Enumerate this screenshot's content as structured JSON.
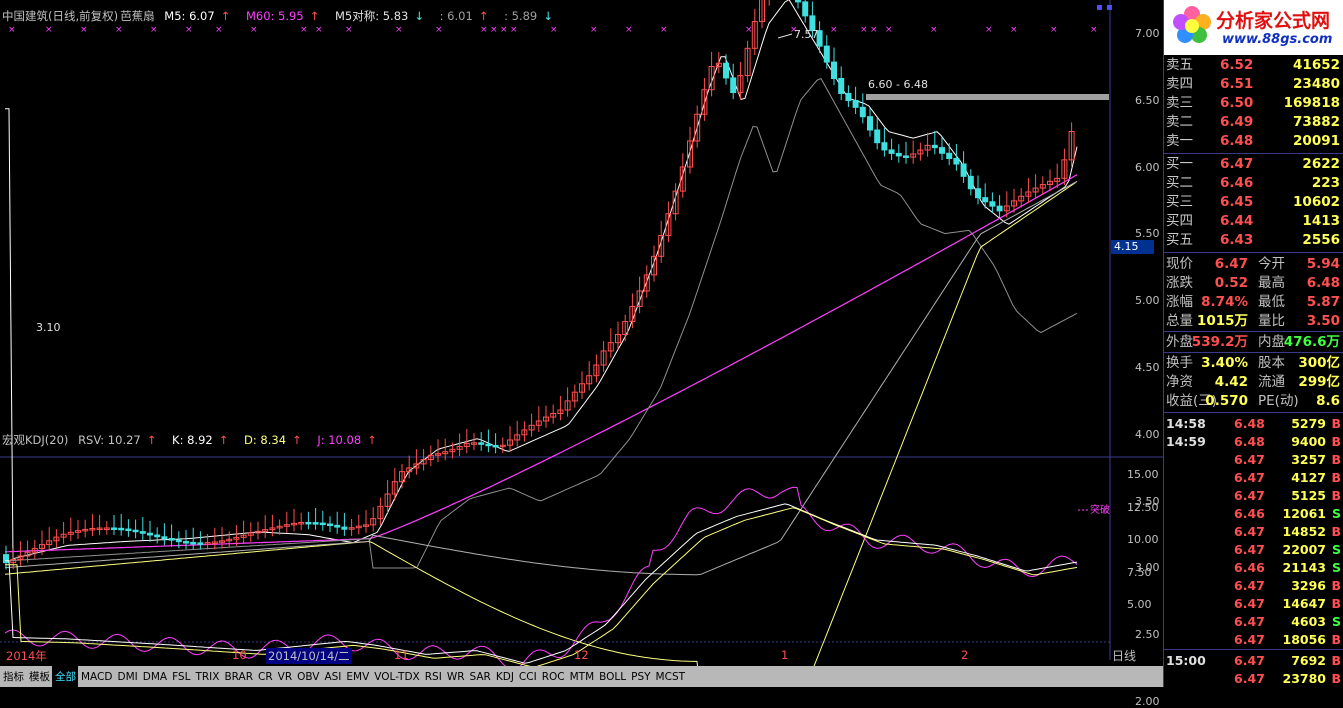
{
  "header": {
    "title": "中国建筑(日线,前复权)",
    "indicator_name": "芭蕉扇",
    "m5": "M5: 6.07",
    "m60": "M60: 5.95",
    "m5sym": "M5对称: 5.83",
    "v1": ": 6.01",
    "v2": ": 5.89"
  },
  "kdj_header": {
    "name": "宏观KDJ(20)",
    "rsv": "RSV: 10.27",
    "k": "K: 8.92",
    "d": "D: 8.34",
    "j": "J: 10.08"
  },
  "chart_annotations": {
    "high": "7.57",
    "resistance": "6.60 - 6.48",
    "low": "3.10",
    "breakout": "突破",
    "current_price_tag": "4.15"
  },
  "price_axis": [
    "7.00",
    "6.50",
    "6.00",
    "5.50",
    "5.00",
    "4.50",
    "4.00",
    "3.50",
    "3.00",
    "2.50",
    "2.00"
  ],
  "kdj_axis": [
    "15.00",
    "12.50",
    "10.00",
    "7.50",
    "5.00"
  ],
  "date_axis": {
    "year": "2014年",
    "m10": "10",
    "cursor": "2014/10/14/二",
    "m11": "11",
    "m12": "12",
    "m1": "1",
    "m2": "2",
    "period": "日线"
  },
  "tabs": [
    "指标",
    "模板",
    "全部",
    "MACD",
    "DMI",
    "DMA",
    "FSL",
    "TRIX",
    "BRAR",
    "CR",
    "VR",
    "OBV",
    "ASI",
    "EMV",
    "VOL-TDX",
    "RSI",
    "WR",
    "SAR",
    "KDJ",
    "CCI",
    "ROC",
    "MTM",
    "BOLL",
    "PSY",
    "MCST"
  ],
  "logo": {
    "title": "分析家公式网",
    "url": "www.88gs.com"
  },
  "sell_orders": [
    {
      "label": "卖五",
      "price": "6.52",
      "vol": "41652"
    },
    {
      "label": "卖四",
      "price": "6.51",
      "vol": "23480"
    },
    {
      "label": "卖三",
      "price": "6.50",
      "vol": "169818"
    },
    {
      "label": "卖二",
      "price": "6.49",
      "vol": "73882"
    },
    {
      "label": "卖一",
      "price": "6.48",
      "vol": "20091"
    }
  ],
  "buy_orders": [
    {
      "label": "买一",
      "price": "6.47",
      "vol": "2622"
    },
    {
      "label": "买二",
      "price": "6.46",
      "vol": "223"
    },
    {
      "label": "买三",
      "price": "6.45",
      "vol": "10602"
    },
    {
      "label": "买四",
      "price": "6.44",
      "vol": "1413"
    },
    {
      "label": "买五",
      "price": "6.43",
      "vol": "2556"
    }
  ],
  "quote": [
    {
      "l1": "现价",
      "v1": "6.47",
      "l2": "今开",
      "v2": "5.94",
      "c1": "#ff5050",
      "c2": "#ff5050"
    },
    {
      "l1": "涨跌",
      "v1": "0.52",
      "l2": "最高",
      "v2": "6.48",
      "c1": "#ff5050",
      "c2": "#ff5050"
    },
    {
      "l1": "涨幅",
      "v1": "8.74%",
      "l2": "最低",
      "v2": "5.87",
      "c1": "#ff5050",
      "c2": "#ff5050"
    },
    {
      "l1": "总量",
      "v1": "1015万",
      "l2": "量比",
      "v2": "3.50",
      "c1": "#ffff55",
      "c2": "#ff5050"
    },
    {
      "l1": "外盘",
      "v1": "539.2万",
      "l2": "内盘",
      "v2": "476.6万",
      "c1": "#ff5050",
      "c2": "#40ff40"
    },
    {
      "l1": "换手",
      "v1": "3.40%",
      "l2": "股本",
      "v2": "300亿",
      "c1": "#ffff55",
      "c2": "#ffff55"
    },
    {
      "l1": "净资",
      "v1": "4.42",
      "l2": "流通",
      "v2": "299亿",
      "c1": "#ffff55",
      "c2": "#ffff55"
    },
    {
      "l1": "收益(三)",
      "v1": "0.570",
      "l2": "PE(动)",
      "v2": "8.6",
      "c1": "#ffff55",
      "c2": "#ffff55"
    }
  ],
  "ticks": [
    {
      "time": "14:58",
      "price": "6.48",
      "vol": "5279",
      "flag": "B"
    },
    {
      "time": "14:59",
      "price": "6.48",
      "vol": "9400",
      "flag": "B"
    },
    {
      "time": "",
      "price": "6.47",
      "vol": "3257",
      "flag": "B"
    },
    {
      "time": "",
      "price": "6.47",
      "vol": "4127",
      "flag": "B"
    },
    {
      "time": "",
      "price": "6.47",
      "vol": "5125",
      "flag": "B"
    },
    {
      "time": "",
      "price": "6.46",
      "vol": "12061",
      "flag": "S"
    },
    {
      "time": "",
      "price": "6.47",
      "vol": "14852",
      "flag": "B"
    },
    {
      "time": "",
      "price": "6.47",
      "vol": "22007",
      "flag": "S"
    },
    {
      "time": "",
      "price": "6.46",
      "vol": "21143",
      "flag": "S"
    },
    {
      "time": "",
      "price": "6.47",
      "vol": "3296",
      "flag": "B"
    },
    {
      "time": "",
      "price": "6.47",
      "vol": "14647",
      "flag": "B"
    },
    {
      "time": "",
      "price": "6.47",
      "vol": "4603",
      "flag": "S"
    },
    {
      "time": "",
      "price": "6.47",
      "vol": "18056",
      "flag": "B"
    },
    {
      "time": "15:00",
      "price": "6.47",
      "vol": "7692",
      "flag": "B"
    },
    {
      "time": "",
      "price": "6.47",
      "vol": "23780",
      "flag": "B"
    }
  ],
  "colors": {
    "up": "#ff5050",
    "down": "#40e0e0",
    "buy_flag": "#ff5050",
    "sell_flag": "#40ff40",
    "m60": "#ff40ff",
    "yellow": "#ffff80"
  }
}
